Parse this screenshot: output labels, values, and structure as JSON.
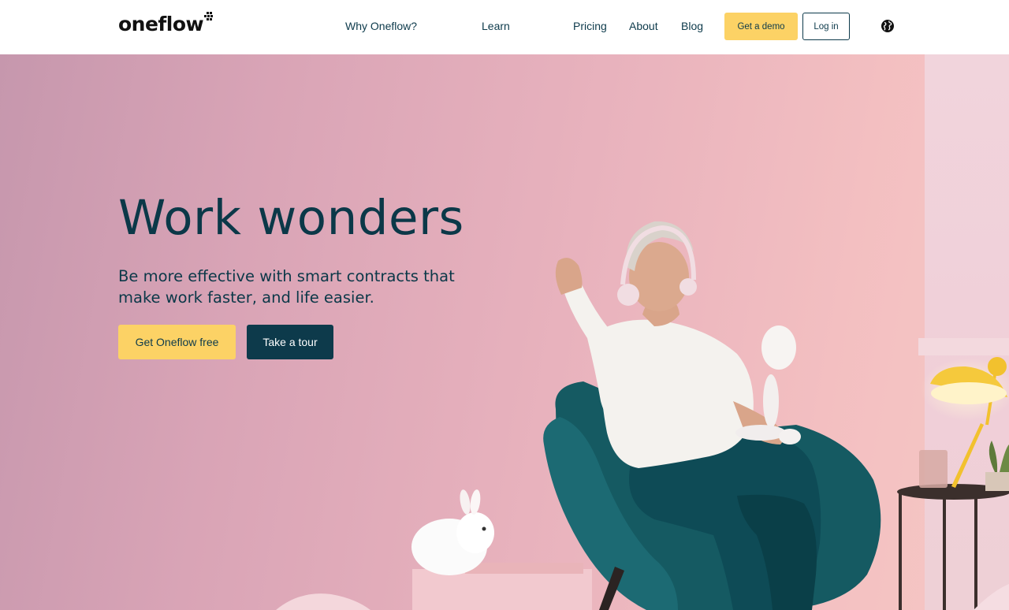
{
  "header": {
    "logo": "oneflow",
    "nav": [
      {
        "label": "Why Oneflow?"
      },
      {
        "label": "Learn"
      },
      {
        "label": "Pricing"
      },
      {
        "label": "About"
      },
      {
        "label": "Blog"
      }
    ],
    "demo_label": "Get a demo",
    "login_label": "Log in",
    "language_icon": "globe-icon"
  },
  "hero": {
    "title": "Work wonders",
    "subtitle": "Be more effective with smart contracts that make work faster, and life easier.",
    "primary_cta": "Get Oneflow free",
    "secondary_cta": "Take a tour"
  },
  "colors": {
    "brand_dark": "#0d3a4b",
    "accent_yellow": "#fcd265",
    "hero_pink": "#e8b2bd"
  }
}
